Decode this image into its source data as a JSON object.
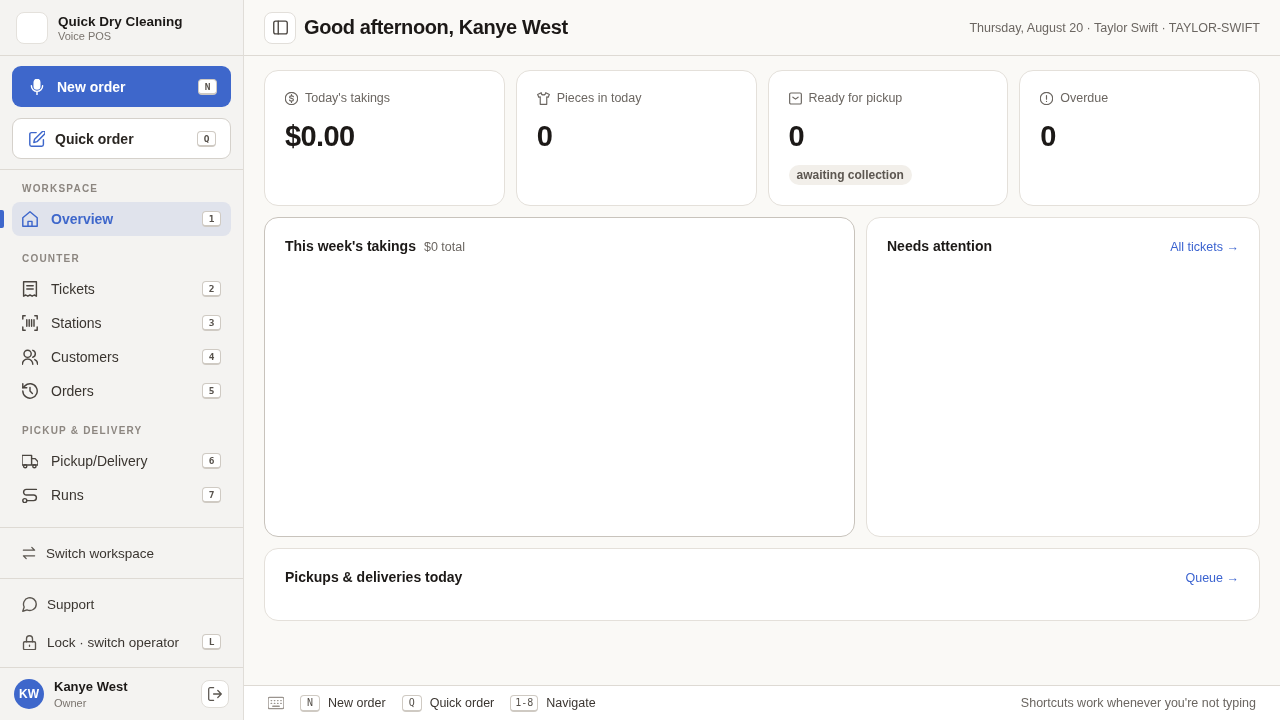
{
  "brand": {
    "name": "Quick Dry Cleaning",
    "subtitle": "Voice POS"
  },
  "actions": [
    {
      "kind": "primary",
      "label": "New order",
      "shortcut": "N"
    },
    {
      "kind": "secondary",
      "label": "Quick order",
      "shortcut": "Q"
    }
  ],
  "nav": [
    {
      "heading": "WORKSPACE",
      "items": [
        {
          "label": "Overview",
          "shortcut": "1",
          "selected": true
        }
      ]
    },
    {
      "heading": "COUNTER",
      "items": [
        {
          "label": "Tickets",
          "shortcut": "2",
          "selected": false
        },
        {
          "label": "Stations",
          "shortcut": "3",
          "selected": false
        },
        {
          "label": "Customers",
          "shortcut": "4",
          "selected": false
        },
        {
          "label": "Orders",
          "shortcut": "5",
          "selected": false
        }
      ]
    },
    {
      "heading": "PICKUP & DELIVERY",
      "items": [
        {
          "label": "Pickup/Delivery",
          "shortcut": "6",
          "selected": false
        },
        {
          "label": "Runs",
          "shortcut": "7",
          "selected": false
        }
      ]
    }
  ],
  "sidebar_footer": {
    "switch": "Switch workspace",
    "links": [
      {
        "label": "Support"
      },
      {
        "label": "Lock · switch operator",
        "shortcut": "L"
      }
    ]
  },
  "user": {
    "initials": "KW",
    "name": "Kanye West",
    "role": "Owner"
  },
  "header": {
    "greeting": "Good afternoon, Kanye West",
    "context": "Thursday, August 20 · Taylor Swift · TAYLOR-SWIFT"
  },
  "stats": [
    {
      "label": "Today's takings",
      "value": "$0.00"
    },
    {
      "label": "Pieces in today",
      "value": "0"
    },
    {
      "label": "Ready for pickup",
      "value": "0",
      "tag": "awaiting collection"
    },
    {
      "label": "Overdue",
      "value": "0"
    }
  ],
  "panels": [
    {
      "title": "This week's takings",
      "note": "$0 total"
    },
    {
      "title": "Needs attention",
      "link": "All tickets →"
    },
    {
      "title": "Pickups & deliveries today",
      "link": "Queue →"
    }
  ],
  "status_bar": {
    "shortcuts": [
      {
        "key": "N",
        "label": "New order"
      },
      {
        "key": "Q",
        "label": "Quick order"
      },
      {
        "key": "1-8",
        "label": "Navigate"
      }
    ],
    "hint": "Shortcuts work whenever you're not typing"
  }
}
